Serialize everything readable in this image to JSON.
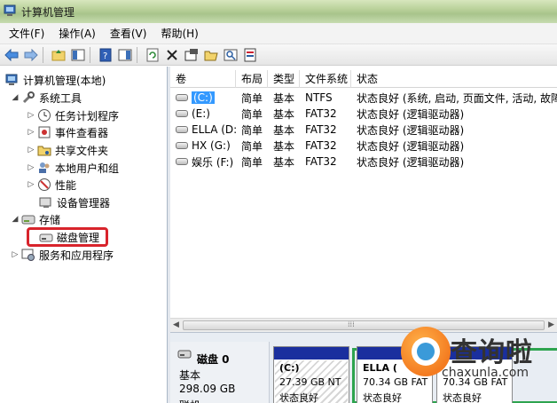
{
  "window": {
    "title": "计算机管理"
  },
  "menu": [
    "文件(F)",
    "操作(A)",
    "查看(V)",
    "帮助(H)"
  ],
  "toolbar_icons": [
    "back-arrow-icon",
    "forward-arrow-icon",
    "up-folder-icon",
    "show-hide-tree-icon",
    "help-icon",
    "show-hide-action-icon",
    "refresh-icon",
    "delete-icon",
    "properties-icon",
    "open-icon",
    "search-icon",
    "export-icon"
  ],
  "tree": {
    "root": "计算机管理(本地)",
    "system_tools": "系统工具",
    "task_scheduler": "任务计划程序",
    "event_viewer": "事件查看器",
    "shared_folders": "共享文件夹",
    "local_users": "本地用户和组",
    "performance": "性能",
    "device_manager": "设备管理器",
    "storage": "存储",
    "disk_management": "磁盘管理",
    "services": "服务和应用程序"
  },
  "list": {
    "columns": [
      "卷",
      "布局",
      "类型",
      "文件系统",
      "状态"
    ],
    "rows": [
      {
        "vol": "(C:)",
        "layout": "简单",
        "type": "基本",
        "fs": "NTFS",
        "status": "状态良好 (系统, 启动, 页面文件, 活动, 故障"
      },
      {
        "vol": "(E:)",
        "layout": "简单",
        "type": "基本",
        "fs": "FAT32",
        "status": "状态良好 (逻辑驱动器)"
      },
      {
        "vol": "ELLA (D:)",
        "layout": "简单",
        "type": "基本",
        "fs": "FAT32",
        "status": "状态良好 (逻辑驱动器)"
      },
      {
        "vol": "HX (G:)",
        "layout": "简单",
        "type": "基本",
        "fs": "FAT32",
        "status": "状态良好 (逻辑驱动器)"
      },
      {
        "vol": "娱乐 (F:)",
        "layout": "简单",
        "type": "基本",
        "fs": "FAT32",
        "status": "状态良好 (逻辑驱动器)"
      }
    ],
    "scroll_grip": "⁞⁞⁞"
  },
  "disk": {
    "name": "磁盘 0",
    "type": "基本",
    "size": "298.09 GB",
    "status": "联机",
    "partitions": [
      {
        "name": "(C:)",
        "info": "27.39 GB NT",
        "status": "状态良好"
      },
      {
        "name": "ELLA (",
        "info": "70.34 GB FAT",
        "status": "状态良好"
      },
      {
        "name": "",
        "info": "70.34 GB FAT",
        "status": "状态良好"
      }
    ]
  },
  "watermark": {
    "brand": "查询啦",
    "url": "chaxunla.com"
  },
  "colors": {
    "accent_red": "#d8242c",
    "partition_bar": "#1a2f9e",
    "extended_green": "#2ea44f",
    "selection_blue": "#3399ff"
  }
}
